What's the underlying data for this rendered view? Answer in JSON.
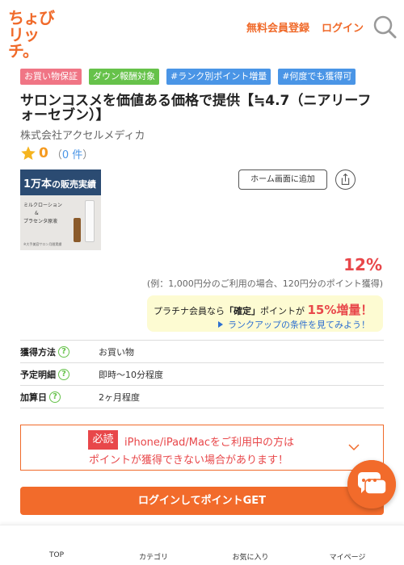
{
  "header": {
    "logo_line1": "ちょび",
    "logo_line2": "リッチ。",
    "register": "無料会員登録",
    "login": "ログイン",
    "search_icon": "search-icon"
  },
  "tags": [
    "お買い物保証",
    "ダウン報酬対象",
    "#ランク別ポイント増量",
    "#何度でも獲得可"
  ],
  "product": {
    "title": "サロンコスメを価値ある価格で提供【≒4.7（ニアリーフォーセブン）】",
    "company": "株式会社アクセルメディカ",
    "rating_value": "0",
    "rating_open": "（",
    "rating_count": "0 件",
    "rating_close": "）",
    "image_banner_big": "1万本",
    "image_banner_rest": "の販売実績",
    "image_text1": "ミルクローション",
    "image_text2": "&",
    "image_text3": "プラセンタ原液",
    "image_foot": "※大手美容サロン月間実績"
  },
  "actions": {
    "add_home": "ホーム画面に追加",
    "share_icon": "share-icon"
  },
  "reward": {
    "percent": "12%",
    "example": "(例：1,000円分のご利用の場合、120円分のポイント獲得)",
    "promo_prefix": "プラチナ会員なら",
    "promo_bold": "「確定」",
    "promo_mid": "ポイントが",
    "promo_highlight": "15%増量！",
    "promo_link": "ランクアップの条件を見てみよう！"
  },
  "info": [
    {
      "key": "獲得方法",
      "value": "お買い物"
    },
    {
      "key": "予定明細",
      "value": "即時〜10分程度"
    },
    {
      "key": "加算日",
      "value": "2ヶ月程度"
    }
  ],
  "notice": {
    "badge": "必読",
    "line1": "iPhone/iPad/Macをご利用中の方は",
    "line2": "ポイントが獲得できない場合があります！"
  },
  "cta": "ログインしてポイントGET",
  "bottom_nav": [
    "TOP",
    "カテゴリ",
    "お気に入り",
    "マイページ"
  ],
  "colors": {
    "brand": "#f06a2a",
    "accent_red": "#e8474a",
    "tag_pink": "#f07585",
    "tag_green": "#66c24a",
    "tag_blue": "#4a95e6"
  }
}
